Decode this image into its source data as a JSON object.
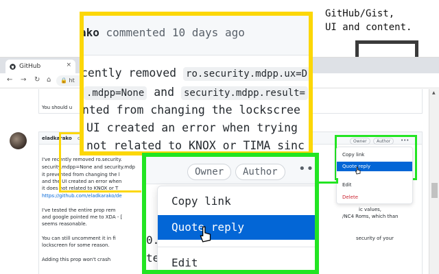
{
  "caption": {
    "line1": "GitHub/Gist,",
    "line2": "UI and content."
  },
  "browser": {
    "tab_title": "GitHub",
    "tab_close": "×",
    "new_tab": "+",
    "url_text": "ht"
  },
  "page": {
    "top_text": "You should u",
    "comment_author": "eladkarako",
    "comment_author_extra": "c",
    "lines": [
      "I've recently removed ro.security.",
      "security.mdpp=None and security.mdp",
      "it prevented from changing the l",
      "and the UI created an error when",
      "it does not related to KNOX or T",
      "https://github.com/eladkarako/de",
      "I've tested the entire prop rem",
      "and google pointed me to XDA - [",
      "seems reasonable.",
      "You can still uncomment it in fi",
      "lockscreen for some reason.",
      "Adding this prop won't crash"
    ],
    "right_fragments": [
      "ic values,",
      "/NC4 Roms, which than",
      "security of your"
    ]
  },
  "small_menu": {
    "owner": "Owner",
    "author": "Author",
    "dots": "•••",
    "copy_link": "Copy link",
    "quote_reply": "Quote reply",
    "edit": "Edit",
    "delete": "Delete"
  },
  "yellow_zoom": {
    "author_fragment": "ako",
    "commented": "commented 10 days ago",
    "line1_prefix": "cently removed",
    "line1_code": "ro.security.mdpp.ux=D",
    "line2_code1": ".mdpp=None",
    "line2_and": "and",
    "line2_code2": "security.mdpp.result=",
    "line3": "nted from changing the lockscree",
    "line4": "UI created an error when trying",
    "line5": "not related to KNOX or TIMA sinc"
  },
  "green_zoom": {
    "owner": "Owner",
    "author": "Author",
    "dots": "•••",
    "copy_link": "Copy link",
    "quote_reply": "Quote reply",
    "edit": "Edit",
    "left_fragment1": "0.",
    "left_fragment2": "te"
  },
  "colors": {
    "yellow_outline": "#fcd707",
    "green_outline": "#22e522",
    "active_blue": "#0366d6",
    "delete_red": "#cb2431"
  }
}
